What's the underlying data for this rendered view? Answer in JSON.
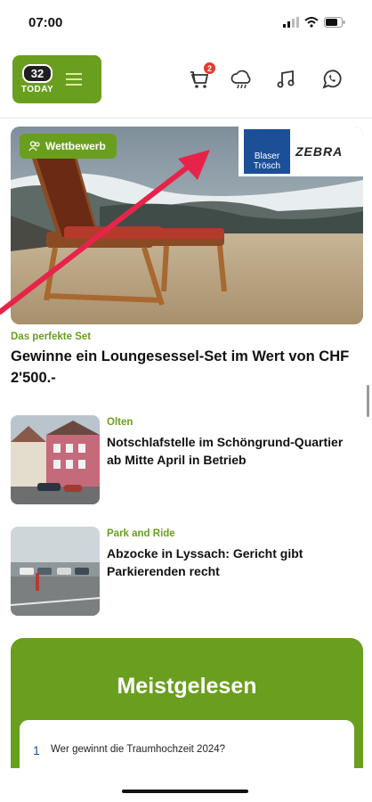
{
  "status_bar": {
    "time": "07:00"
  },
  "header": {
    "logo_number": "32",
    "logo_text": "TODAY",
    "cart_badge": "2",
    "icons": [
      "menu-icon",
      "cart-icon",
      "weather-icon",
      "music-icon",
      "whatsapp-icon"
    ]
  },
  "hero": {
    "badge_label": "Wettbewerb",
    "sponsor_left_line1": "Blaser",
    "sponsor_left_line2": "Trösch",
    "sponsor_right": "ZEBRA",
    "kicker": "Das perfekte Set",
    "title": "Gewinne ein Loungesessel-Set im Wert von CHF 2'500.-"
  },
  "articles": [
    {
      "kicker": "Olten",
      "title": "Notschlafstelle im Schöngrund-Quartier ab Mitte April in Betrieb"
    },
    {
      "kicker": "Park and Ride",
      "title": "Abzocke in Lyssach: Gericht gibt Parkierenden recht"
    }
  ],
  "most_read": {
    "title": "Meistgelesen",
    "items": [
      {
        "rank": "1",
        "title": "Wer gewinnt die Traumhochzeit 2024?"
      }
    ]
  },
  "colors": {
    "brand_green": "#6a9e1f",
    "kicker_green": "#6a9e1f",
    "badge_red": "#e23b2e",
    "arrow_red": "#e8234a"
  }
}
